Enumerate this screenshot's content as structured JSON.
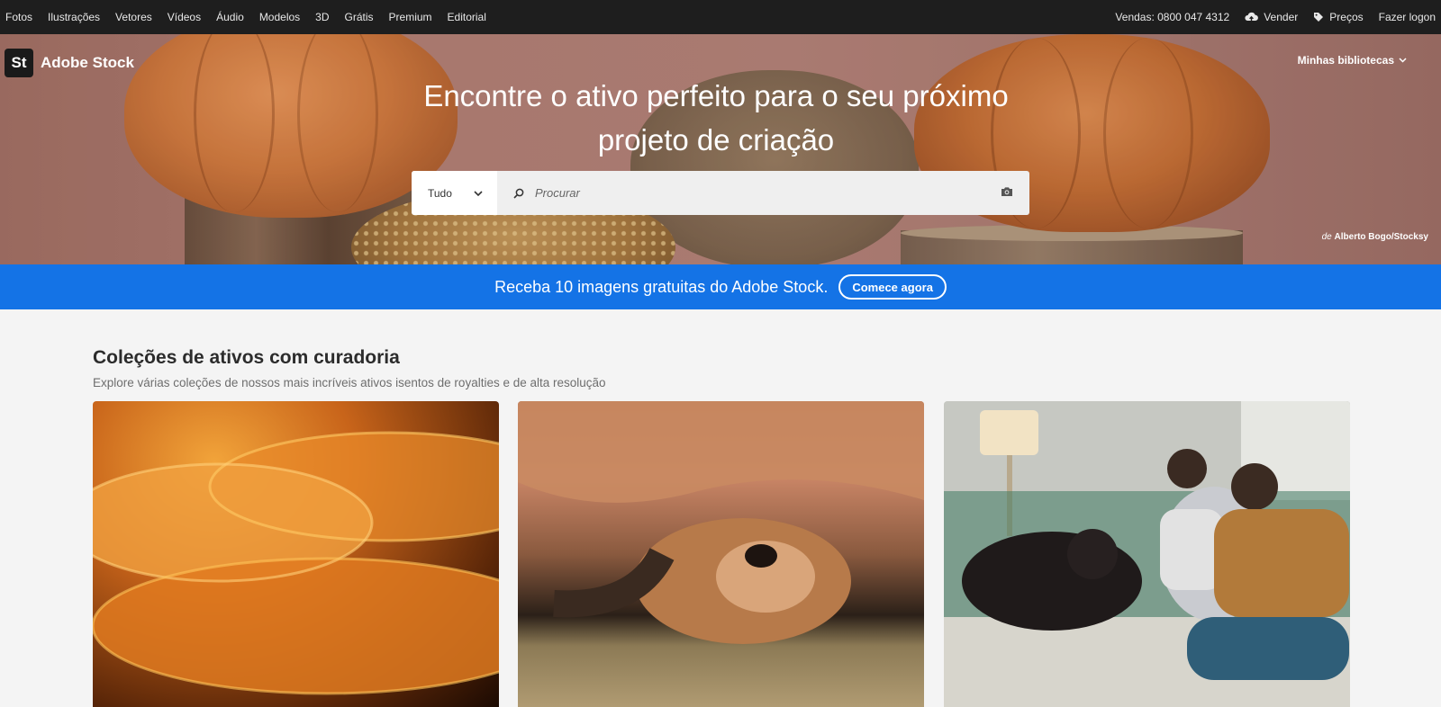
{
  "topnav": {
    "left_items": [
      "Fotos",
      "Ilustrações",
      "Vetores",
      "Vídeos",
      "Áudio",
      "Modelos",
      "3D",
      "Grátis",
      "Premium",
      "Editorial"
    ],
    "phone": "Vendas: 0800 047 4312",
    "sell": "Vender",
    "pricing": "Preços",
    "login": "Fazer logon"
  },
  "logo": {
    "badge": "St",
    "name": "Adobe Stock"
  },
  "libraries": "Minhas bibliotecas",
  "hero": {
    "title_line1": "Encontre o ativo perfeito para o seu próximo",
    "title_line2": "projeto de criação",
    "credit_prefix": "de",
    "credit_author": "Alberto Bogo/Stocksy"
  },
  "search": {
    "category": "Tudo",
    "placeholder": "Procurar",
    "value": ""
  },
  "promo": {
    "text": "Receba 10 imagens gratuitas do Adobe Stock.",
    "button": "Comece agora"
  },
  "collections": {
    "title": "Coleções de ativos com curadoria",
    "subtitle": "Explore várias coleções de nossos mais incríveis ativos isentos de royalties e de alta resolução"
  },
  "colors": {
    "topnav_bg": "#1e1e1e",
    "promo_blue": "#1473e6",
    "page_bg": "#f4f4f4"
  },
  "icons": [
    "upload-cloud-icon",
    "price-tag-icon",
    "chevron-down-icon",
    "search-icon",
    "camera-icon"
  ]
}
